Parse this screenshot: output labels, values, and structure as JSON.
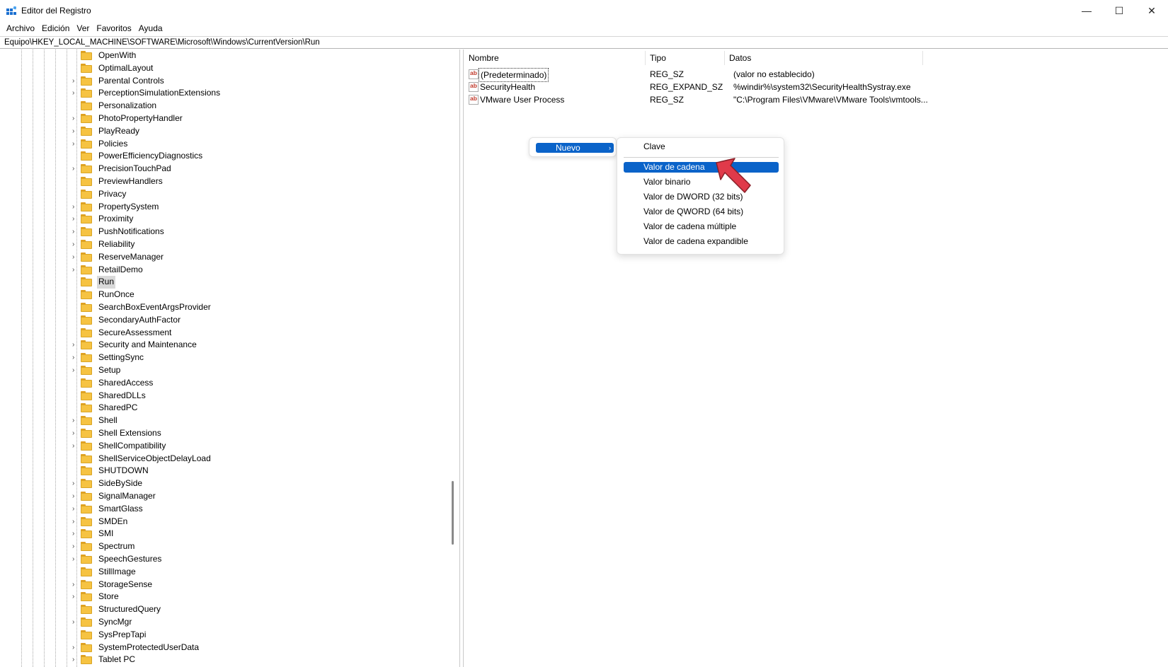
{
  "window": {
    "title": "Editor del Registro",
    "controls": {
      "minimize": "—",
      "maximize": "☐",
      "close": "✕"
    }
  },
  "menubar": [
    "Archivo",
    "Edición",
    "Ver",
    "Favoritos",
    "Ayuda"
  ],
  "address": "Equipo\\HKEY_LOCAL_MACHINE\\SOFTWARE\\Microsoft\\Windows\\CurrentVersion\\Run",
  "tree": [
    {
      "label": "OpenWith",
      "expandable": false
    },
    {
      "label": "OptimalLayout",
      "expandable": false
    },
    {
      "label": "Parental Controls",
      "expandable": true
    },
    {
      "label": "PerceptionSimulationExtensions",
      "expandable": true
    },
    {
      "label": "Personalization",
      "expandable": false
    },
    {
      "label": "PhotoPropertyHandler",
      "expandable": true
    },
    {
      "label": "PlayReady",
      "expandable": true
    },
    {
      "label": "Policies",
      "expandable": true
    },
    {
      "label": "PowerEfficiencyDiagnostics",
      "expandable": false
    },
    {
      "label": "PrecisionTouchPad",
      "expandable": true
    },
    {
      "label": "PreviewHandlers",
      "expandable": false
    },
    {
      "label": "Privacy",
      "expandable": false
    },
    {
      "label": "PropertySystem",
      "expandable": true
    },
    {
      "label": "Proximity",
      "expandable": true
    },
    {
      "label": "PushNotifications",
      "expandable": true
    },
    {
      "label": "Reliability",
      "expandable": true
    },
    {
      "label": "ReserveManager",
      "expandable": true
    },
    {
      "label": "RetailDemo",
      "expandable": true
    },
    {
      "label": "Run",
      "expandable": false,
      "selected": true
    },
    {
      "label": "RunOnce",
      "expandable": false
    },
    {
      "label": "SearchBoxEventArgsProvider",
      "expandable": false
    },
    {
      "label": "SecondaryAuthFactor",
      "expandable": false
    },
    {
      "label": "SecureAssessment",
      "expandable": false
    },
    {
      "label": "Security and Maintenance",
      "expandable": true
    },
    {
      "label": "SettingSync",
      "expandable": true
    },
    {
      "label": "Setup",
      "expandable": true
    },
    {
      "label": "SharedAccess",
      "expandable": false
    },
    {
      "label": "SharedDLLs",
      "expandable": false
    },
    {
      "label": "SharedPC",
      "expandable": false
    },
    {
      "label": "Shell",
      "expandable": true
    },
    {
      "label": "Shell Extensions",
      "expandable": true
    },
    {
      "label": "ShellCompatibility",
      "expandable": true
    },
    {
      "label": "ShellServiceObjectDelayLoad",
      "expandable": false
    },
    {
      "label": "SHUTDOWN",
      "expandable": false
    },
    {
      "label": "SideBySide",
      "expandable": true
    },
    {
      "label": "SignalManager",
      "expandable": true
    },
    {
      "label": "SmartGlass",
      "expandable": true
    },
    {
      "label": "SMDEn",
      "expandable": true
    },
    {
      "label": "SMI",
      "expandable": true
    },
    {
      "label": "Spectrum",
      "expandable": true
    },
    {
      "label": "SpeechGestures",
      "expandable": true
    },
    {
      "label": "StillImage",
      "expandable": false
    },
    {
      "label": "StorageSense",
      "expandable": true
    },
    {
      "label": "Store",
      "expandable": true
    },
    {
      "label": "StructuredQuery",
      "expandable": false
    },
    {
      "label": "SyncMgr",
      "expandable": true
    },
    {
      "label": "SysPrepTapi",
      "expandable": false
    },
    {
      "label": "SystemProtectedUserData",
      "expandable": true
    },
    {
      "label": "Tablet PC",
      "expandable": true
    }
  ],
  "list": {
    "columns": [
      "Nombre",
      "Tipo",
      "Datos"
    ],
    "rows": [
      {
        "name": "(Predeterminado)",
        "type": "REG_SZ",
        "data": "(valor no establecido)"
      },
      {
        "name": "SecurityHealth",
        "type": "REG_EXPAND_SZ",
        "data": "%windir%\\system32\\SecurityHealthSystray.exe"
      },
      {
        "name": "VMware User Process",
        "type": "REG_SZ",
        "data": "\"C:\\Program Files\\VMware\\VMware Tools\\vmtools..."
      }
    ]
  },
  "context_menu": {
    "main_item": "Nuevo",
    "arrow": "›",
    "submenu": [
      "Clave",
      "Valor de cadena",
      "Valor binario",
      "Valor de DWORD (32 bits)",
      "Valor de QWORD (64 bits)",
      "Valor de cadena múltiple",
      "Valor de cadena expandible"
    ],
    "highlighted": "Valor de cadena"
  },
  "colors": {
    "accent": "#0a63c9",
    "pointer": "#e03a4a",
    "folder": "#f6c342"
  }
}
